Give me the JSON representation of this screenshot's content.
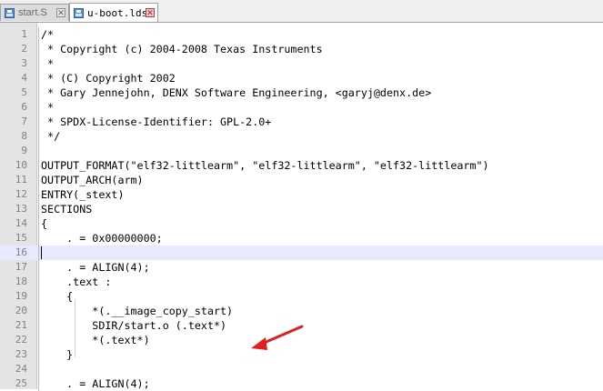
{
  "tabs": [
    {
      "label": "start.S",
      "active": false
    },
    {
      "label": "u-boot.lds",
      "active": true
    }
  ],
  "current_line": 16,
  "lines": [
    {
      "n": "1",
      "text": "/*"
    },
    {
      "n": "2",
      "text": " * Copyright (c) 2004-2008 Texas Instruments"
    },
    {
      "n": "3",
      "text": " *"
    },
    {
      "n": "4",
      "text": " * (C) Copyright 2002"
    },
    {
      "n": "5",
      "text": " * Gary Jennejohn, DENX Software Engineering, <garyj@denx.de>"
    },
    {
      "n": "6",
      "text": " *"
    },
    {
      "n": "7",
      "text": " * SPDX-License-Identifier: GPL-2.0+"
    },
    {
      "n": "8",
      "text": " */"
    },
    {
      "n": "9",
      "text": ""
    },
    {
      "n": "10",
      "text": "OUTPUT_FORMAT(\"elf32-littlearm\", \"elf32-littlearm\", \"elf32-littlearm\")"
    },
    {
      "n": "11",
      "text": "OUTPUT_ARCH(arm)"
    },
    {
      "n": "12",
      "text": "ENTRY(_stext)"
    },
    {
      "n": "13",
      "text": "SECTIONS"
    },
    {
      "n": "14",
      "text": "{"
    },
    {
      "n": "15",
      "text": "    . = 0x00000000;"
    },
    {
      "n": "16",
      "text": ""
    },
    {
      "n": "17",
      "text": "    . = ALIGN(4);"
    },
    {
      "n": "18",
      "text": "    .text :"
    },
    {
      "n": "19",
      "text": "    {"
    },
    {
      "n": "20",
      "text": "        *(.__image_copy_start)"
    },
    {
      "n": "21",
      "text": "        SDIR/start.o (.text*)"
    },
    {
      "n": "22",
      "text": "        *(.text*)"
    },
    {
      "n": "23",
      "text": "    }"
    },
    {
      "n": "24",
      "text": ""
    },
    {
      "n": "25",
      "text": "    . = ALIGN(4);"
    }
  ],
  "annotation": {
    "icon": "red-arrow-icon",
    "color": "#e02020",
    "points_to_line": 21
  },
  "colors": {
    "gutter": "#e4e4e4",
    "current_line": "#e8e8ff",
    "line_number": "#808080"
  }
}
